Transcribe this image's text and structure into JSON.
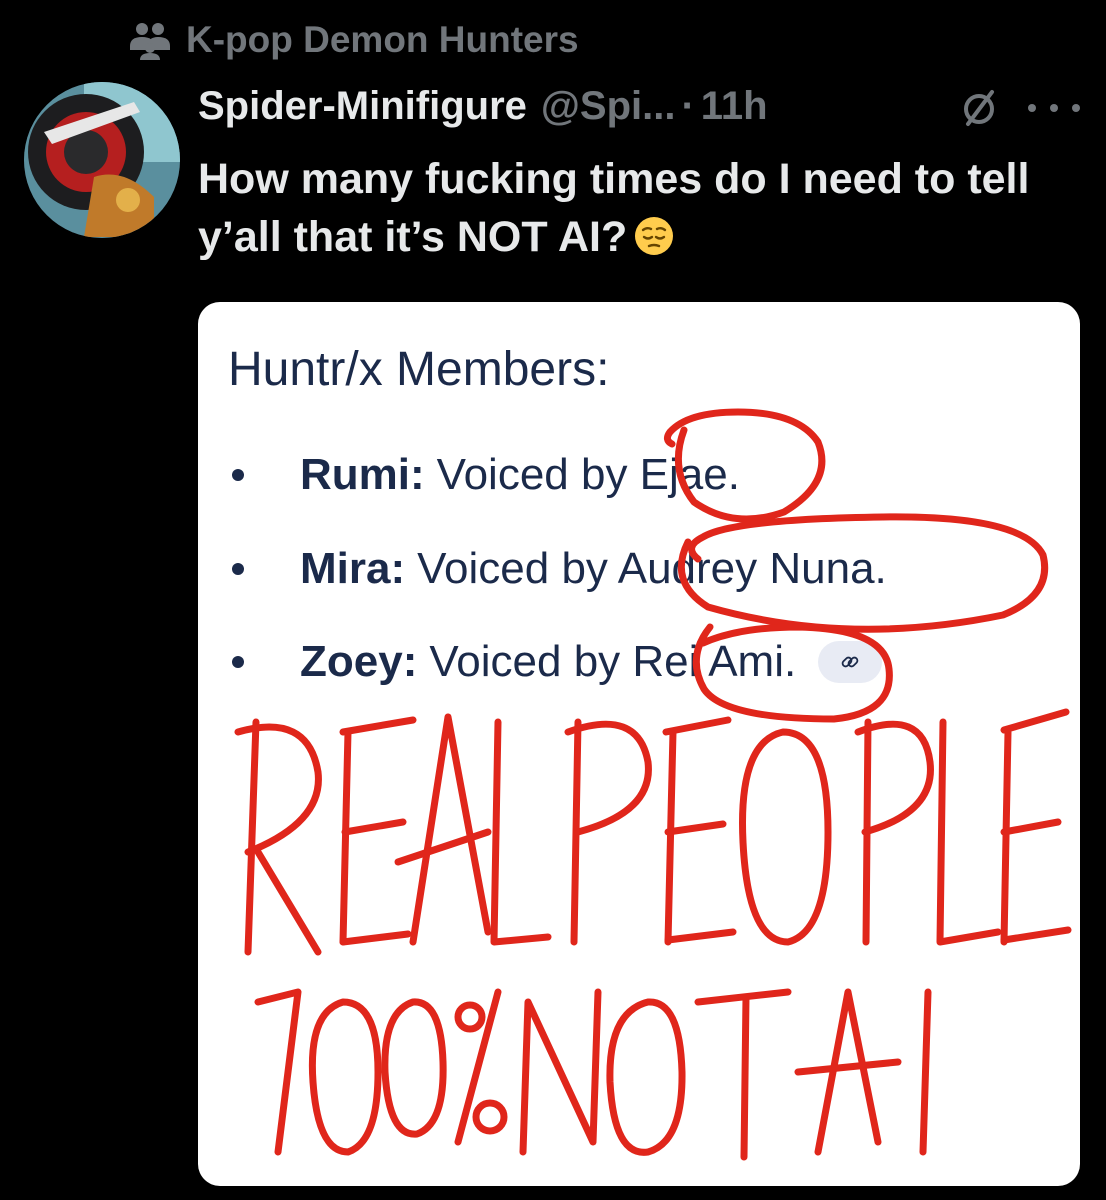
{
  "context": {
    "community_icon": "community-icon",
    "community_name": "K-pop Demon Hunters"
  },
  "post": {
    "display_name": "Spider-Minifigure",
    "handle": "@Spi...",
    "separator": "·",
    "time": "11h",
    "text": "How many fucking times do I need to tell y’all that it’s NOT AI?",
    "emoji": "pensive-face-emoji",
    "icons": [
      "grok-icon",
      "more-icon"
    ]
  },
  "media": {
    "title": "Huntr/x Members:",
    "members": [
      {
        "name": "Rumi:",
        "voiced_by": "Voiced by Ejae."
      },
      {
        "name": "Mira:",
        "voiced_by": "Voiced by Audrey Nuna."
      },
      {
        "name": "Zoey:",
        "voiced_by": "Voiced by Rei Ami."
      }
    ],
    "link_icon": "link-icon",
    "handwriting_line1": "REAL PEOPLE",
    "handwriting_line2": "100% NOT AI",
    "annotation_color": "#e0261b"
  },
  "colors": {
    "background": "#000000",
    "primary_text": "#e7e9ea",
    "secondary_text": "#71767b",
    "card_text": "#1b2a4a"
  }
}
